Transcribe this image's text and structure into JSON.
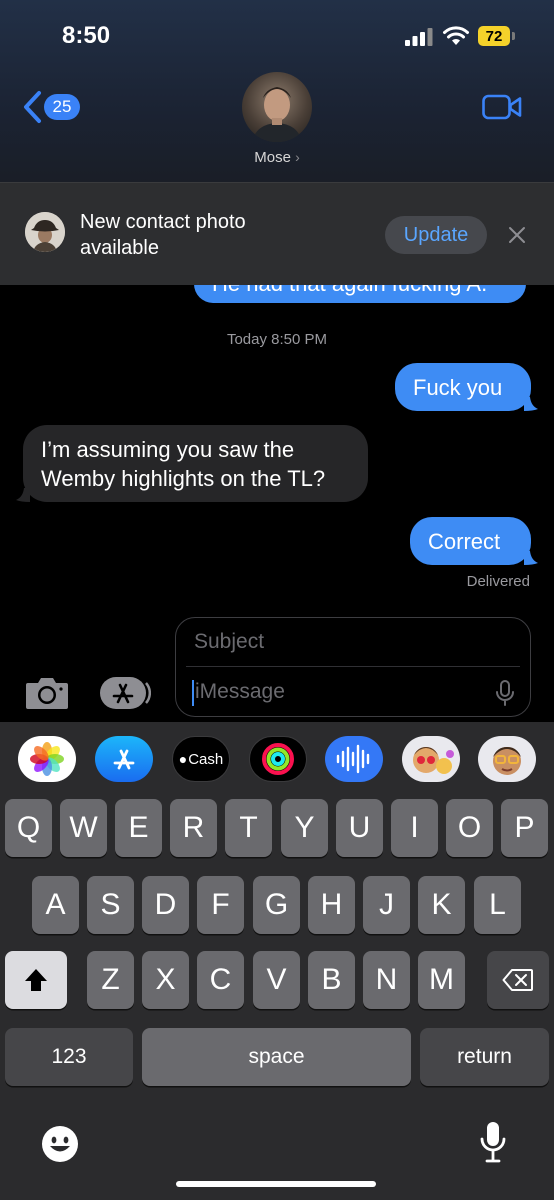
{
  "status_bar": {
    "time": "8:50",
    "battery": "72"
  },
  "header": {
    "back_count": "25",
    "contact_name": "Mose"
  },
  "banner": {
    "text": "New contact photo available",
    "update_label": "Update"
  },
  "conversation": {
    "partial_bubble": "He had that again fucking A.",
    "timestamp": "Today 8:50 PM",
    "messages": [
      {
        "direction": "outgoing",
        "text": "Fuck you"
      },
      {
        "direction": "incoming",
        "text": "I’m assuming you saw the Wemby highlights on the TL?"
      },
      {
        "direction": "outgoing",
        "text": "Correct"
      }
    ],
    "delivered": "Delivered"
  },
  "compose": {
    "subject_placeholder": "Subject",
    "message_placeholder": "iMessage"
  },
  "app_strip": [
    "photos-icon",
    "app-store-icon",
    "apple-cash-icon",
    "activity-icon",
    "audio-message-icon",
    "memoji-stickers-icon",
    "memoji-icon"
  ],
  "app_strip_labels": {
    "cash": "Cash"
  },
  "keyboard": {
    "row1": [
      "Q",
      "W",
      "E",
      "R",
      "T",
      "Y",
      "U",
      "I",
      "O",
      "P"
    ],
    "row2": [
      "A",
      "S",
      "D",
      "F",
      "G",
      "H",
      "J",
      "K",
      "L"
    ],
    "row3": [
      "Z",
      "X",
      "C",
      "V",
      "B",
      "N",
      "M"
    ],
    "numbers_label": "123",
    "space_label": "space",
    "return_label": "return"
  },
  "colors": {
    "accent": "#3e8cf4",
    "incoming_bubble": "#262628",
    "battery": "#f5d22a"
  }
}
